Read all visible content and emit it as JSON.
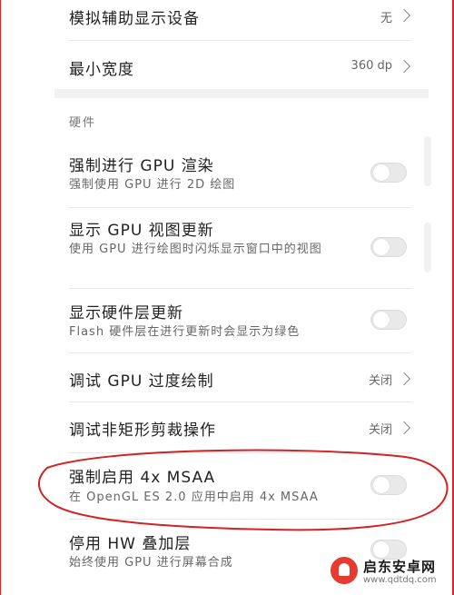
{
  "rows_top": [
    {
      "title": "模拟辅助显示设备",
      "value": "无"
    },
    {
      "title": "最小宽度",
      "value": "360 dp"
    }
  ],
  "section_label": "硬件",
  "rows": [
    {
      "title": "强制进行 GPU 渲染",
      "subtitle": "强制使用 GPU 进行 2D 绘图",
      "control": "toggle",
      "on": false
    },
    {
      "title": "显示 GPU 视图更新",
      "subtitle": "使用 GPU 进行绘图时闪烁显示窗口中的视图",
      "control": "toggle",
      "on": false
    },
    {
      "title": "显示硬件层更新",
      "subtitle": "Flash 硬件层在进行更新时会显示为绿色",
      "control": "toggle",
      "on": false
    },
    {
      "title": "调试 GPU 过度绘制",
      "value": "关闭",
      "control": "chevron"
    },
    {
      "title": "调试非矩形剪裁操作",
      "value": "关闭",
      "control": "chevron"
    },
    {
      "title": "强制启用 4x MSAA",
      "subtitle": "在 OpenGL ES 2.0 应用中启用 4x MSAA",
      "control": "toggle",
      "on": false
    },
    {
      "title": "停用 HW 叠加层",
      "subtitle": "始终使用 GPU 进行屏幕合成",
      "control": "toggle",
      "on": false
    }
  ],
  "watermark": {
    "name": "启东安卓网",
    "url": "www.qdtdq.com"
  },
  "colors": {
    "annotation": "#d22222",
    "toggle_off": "#e9e9e9",
    "divider": "#e8e8e8"
  }
}
